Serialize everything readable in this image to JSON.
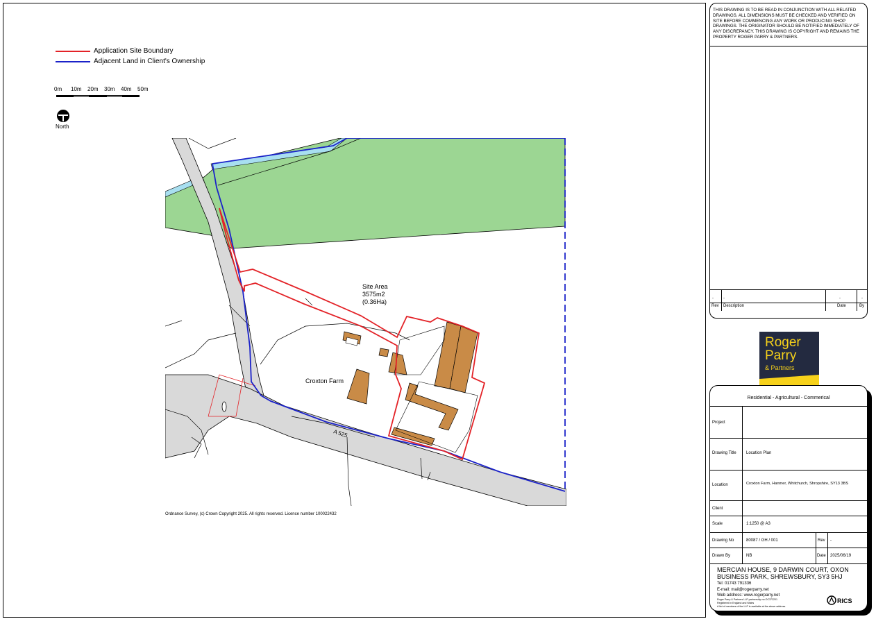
{
  "legend": {
    "boundary_label": "Application Site Boundary",
    "boundary_color": "#e32227",
    "ownership_label": "Adjacent Land in Client's Ownership",
    "ownership_color": "#1b22c9"
  },
  "scale_bar": {
    "labels": [
      "0m",
      "10m",
      "20m",
      "30m",
      "40m",
      "50m"
    ]
  },
  "north": {
    "label": "North",
    "icon": "north-arrow-icon"
  },
  "map": {
    "site_area_title": "Site Area",
    "site_area_m2": "3575m2",
    "site_area_ha": "(0.36Ha)",
    "farm_label": "Croxton Farm",
    "road_label": "A 525",
    "copyright": "Ordnance Survey, (c) Crown Copyright 2025. All rights reserved. Licence number 100022432",
    "colors": {
      "field": "#9cd693",
      "road": "#d9d9d9",
      "building": "#c98b47",
      "stream": "#a8dff0"
    }
  },
  "notes": {
    "text": "THIS DRAWING IS TO BE READ IN CONJUNCTION WITH ALL RELATED DRAWINGS.   ALL DIMENSIONS MUST BE CHECKED AND VERIFIED ON SITE BEFORE  COMMENCING ANY WORK OR PRODUCING SHOP DRAWINGS. THE ORIGINATOR  SHOULD BE NOTIFIED IMMEDIATELY OF ANY DISCREPANCY. THIS DRAWING IS COPYRIGHT AND REMAINS  THE PROPERTY ROGER PARRY & PARTNERS."
  },
  "revision_table": {
    "row": {
      "rev": "-",
      "description": "-",
      "date": "-",
      "by": "-"
    },
    "headers": {
      "rev": "Rev",
      "description": "Description",
      "date": "Date",
      "by": "By"
    }
  },
  "logo": {
    "line1": "Roger",
    "line2": "Parry",
    "line3": "& Partners"
  },
  "title_block": {
    "tagline": "Residential - Agricultural - Commerical",
    "project_label": "Project",
    "project_value": "",
    "drawing_title_label": "Drawing Title",
    "drawing_title_value": "Location Plan",
    "location_label": "Location",
    "location_value": "Croxton Farm, Hanmer, Whitchurch, Shropshire, SY13 3BS",
    "client_label": "Client",
    "client_value": "",
    "scale_label": "Scale",
    "scale_value": "1:1250 @ A3",
    "drawing_no_label": "Drawing No",
    "drawing_no_value": "80087 / GH / 001",
    "rev_label": "Rev",
    "rev_value": "-",
    "drawn_by_label": "Drawn By",
    "drawn_by_value": "NB",
    "date_label": "Date",
    "date_value": "2025/06/19"
  },
  "address": {
    "line1": "MERCIAN HOUSE, 9 DARWIN COURT, OXON",
    "line2": "BUSINESS PARK, SHREWSBURY, SY3 5HJ",
    "tel": "Tel: 01743 791336",
    "email": "E-mail: mail@rogerparry.net",
    "web": "Web address: www.rogerparry.net",
    "small1": "Roger Parry & Partners LLP partnership no.OC372201",
    "small2": "Registered in England and Wales",
    "small3": "A list of members of the LLP is available at the above address.",
    "rics": "RICS"
  }
}
